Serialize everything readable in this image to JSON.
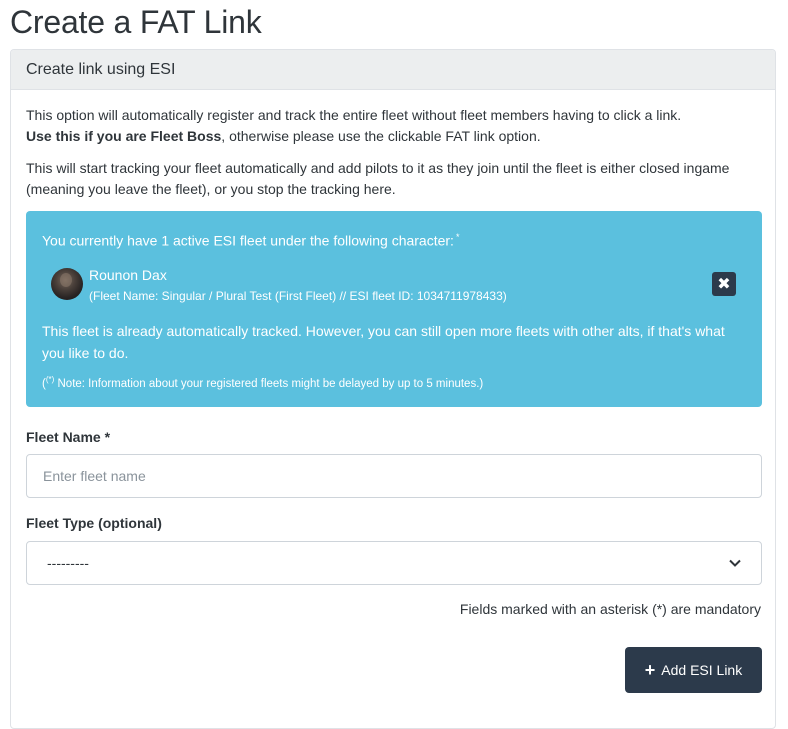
{
  "page": {
    "title": "Create a FAT Link"
  },
  "card": {
    "header": "Create link using ESI",
    "intro1_text": "This option will automatically register and track the entire fleet without fleet members having to click a link.",
    "intro1_bold": "Use this if you are Fleet Boss",
    "intro1_tail": ", otherwise please use the clickable FAT link option.",
    "intro2_text": "This will start tracking your fleet automatically and add pilots to it as they join until the fleet is either closed ingame (meaning you leave the fleet), or you stop the tracking here."
  },
  "alert": {
    "heading": "You currently have 1 active ESI fleet under the following character:",
    "heading_marker": "*",
    "character_name": "Rounon Dax",
    "fleet_meta": "(Fleet Name: Singular / Plural Test (First Fleet) // ESI fleet ID: 1034711978433)",
    "close_label": "✖",
    "info": "This fleet is already automatically tracked. However, you can still open more fleets with other alts, if that's what you like to do.",
    "note_open": "(",
    "note_marker": "(*)",
    "note_text": " Note: Information about your registered fleets might be delayed by up to 5 minutes.)"
  },
  "form": {
    "fleet_name_label": "Fleet Name *",
    "fleet_name_placeholder": "Enter fleet name",
    "fleet_name_value": "",
    "fleet_type_label": "Fleet Type (optional)",
    "fleet_type_selected": "---------",
    "mandatory_note": "Fields marked with an asterisk (*) are mandatory",
    "submit_icon": "+",
    "submit_label": "Add ESI Link"
  },
  "colors": {
    "alert_bg": "#5bc0de",
    "button_bg": "#2c3a4b",
    "header_bg": "#eceeef"
  },
  "icons": {
    "close": "close-icon",
    "plus": "plus-icon",
    "chevron": "chevron-down-icon"
  }
}
